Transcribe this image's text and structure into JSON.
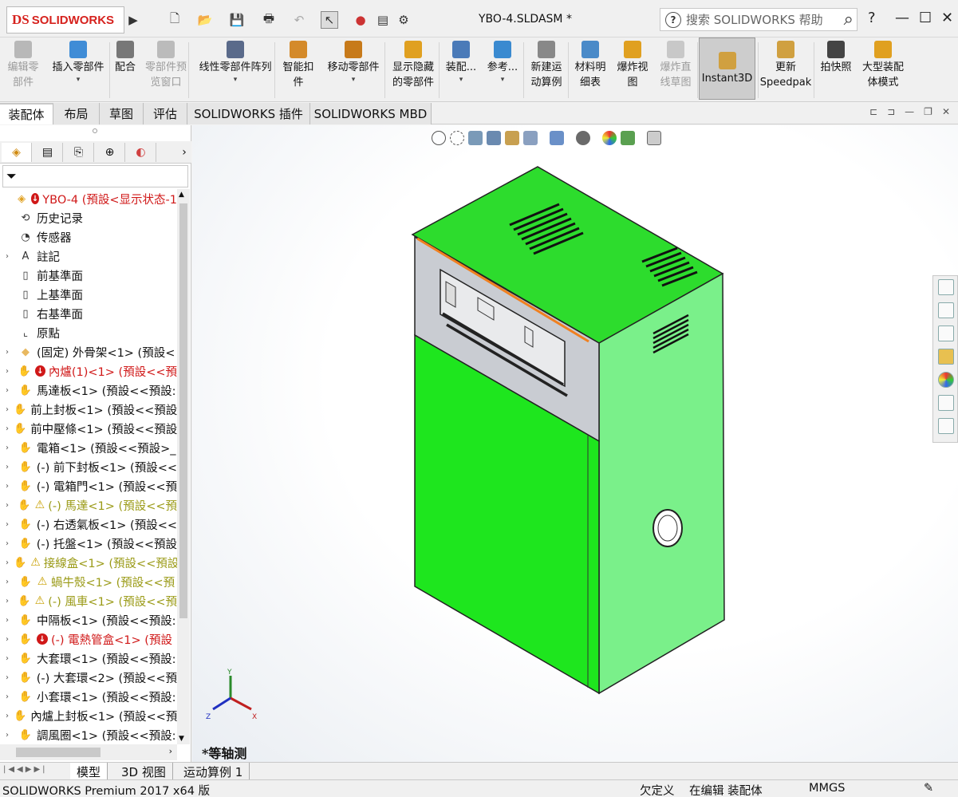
{
  "titlebar": {
    "brand_ds": "DS",
    "brand": "SOLIDWORKS",
    "document_title": "YBO-4.SLDASM *",
    "search_placeholder": "搜索 SOLIDWORKS 帮助",
    "help": "?"
  },
  "commands": [
    {
      "l1": "编辑零",
      "l2": "部件",
      "disabled": true,
      "dd": false,
      "color": "#b8b8b8"
    },
    {
      "l1": "插入零部件",
      "l2": "",
      "disabled": false,
      "dd": true,
      "color": "#3f8cd6"
    },
    {
      "l1": "配合",
      "l2": "",
      "disabled": false,
      "dd": false,
      "color": "#777777"
    },
    {
      "l1": "零部件预",
      "l2": "览窗口",
      "disabled": true,
      "dd": false,
      "color": "#bbbbbb"
    },
    {
      "l1": "线性零部件阵列",
      "l2": "",
      "disabled": false,
      "dd": true,
      "color": "#5a6a8a"
    },
    {
      "l1": "智能扣",
      "l2": "件",
      "disabled": false,
      "dd": false,
      "color": "#d48a2a"
    },
    {
      "l1": "移动零部件",
      "l2": "",
      "disabled": false,
      "dd": true,
      "color": "#c77a1a"
    },
    {
      "l1": "显示隐藏",
      "l2": "的零部件",
      "disabled": false,
      "dd": false,
      "color": "#e0a020"
    },
    {
      "l1": "装配...",
      "l2": "",
      "disabled": false,
      "dd": true,
      "color": "#4a7ab8"
    },
    {
      "l1": "参考...",
      "l2": "",
      "disabled": false,
      "dd": true,
      "color": "#3a8ad0"
    },
    {
      "l1": "新建运",
      "l2": "动算例",
      "disabled": false,
      "dd": false,
      "color": "#888888"
    },
    {
      "l1": "材料明",
      "l2": "细表",
      "disabled": false,
      "dd": false,
      "color": "#4a8ac8"
    },
    {
      "l1": "爆炸视",
      "l2": "图",
      "disabled": false,
      "dd": false,
      "color": "#e0a020"
    },
    {
      "l1": "爆炸直",
      "l2": "线草图",
      "disabled": true,
      "dd": false,
      "color": "#c8c8c8"
    },
    {
      "l1": "Instant3D",
      "l2": "",
      "disabled": false,
      "dd": false,
      "color": "#d0a040"
    },
    {
      "l1": "更新",
      "l2": "Speedpak",
      "disabled": false,
      "dd": false,
      "color": "#d0a040"
    },
    {
      "l1": "拍快照",
      "l2": "",
      "disabled": false,
      "dd": false,
      "color": "#444444"
    },
    {
      "l1": "大型装配",
      "l2": "体模式",
      "disabled": false,
      "dd": false,
      "color": "#e0a020"
    }
  ],
  "tabs": [
    "装配体",
    "布局",
    "草图",
    "评估",
    "SOLIDWORKS 插件",
    "SOLIDWORKS MBD"
  ],
  "tree": [
    {
      "label": "YBO-4  (預設<显示状态-1",
      "status": "error",
      "arrow": "",
      "icon": "#e0a020",
      "iconglyph": "◈"
    },
    {
      "label": "历史记录",
      "status": "",
      "arrow": "",
      "icon": "#ffffff",
      "iconglyph": "⟲"
    },
    {
      "label": "传感器",
      "status": "",
      "arrow": "",
      "icon": "#ffffff",
      "iconglyph": "◔"
    },
    {
      "label": "註記",
      "status": "",
      "arrow": "›",
      "icon": "#ffffff",
      "iconglyph": "A"
    },
    {
      "label": "前基準面",
      "status": "",
      "arrow": "",
      "icon": "#ffffff",
      "iconglyph": "▯"
    },
    {
      "label": "上基準面",
      "status": "",
      "arrow": "",
      "icon": "#ffffff",
      "iconglyph": "▯"
    },
    {
      "label": "右基準面",
      "status": "",
      "arrow": "",
      "icon": "#ffffff",
      "iconglyph": "▯"
    },
    {
      "label": "原點",
      "status": "",
      "arrow": "",
      "icon": "#ffffff",
      "iconglyph": "⌞"
    },
    {
      "label": "(固定) 外骨架<1> (預設<",
      "status": "",
      "arrow": "›",
      "icon": "#e8b860",
      "iconglyph": "◆"
    },
    {
      "label": "內爐(1)<1> (預設<<預",
      "status": "error",
      "arrow": "›",
      "icon": "#f0b020",
      "iconglyph": "✋"
    },
    {
      "label": "馬達板<1> (預設<<預設:",
      "status": "",
      "arrow": "›",
      "icon": "#f0b020",
      "iconglyph": "✋"
    },
    {
      "label": "前上封板<1> (預設<<預設",
      "status": "",
      "arrow": "›",
      "icon": "#f0b020",
      "iconglyph": "✋"
    },
    {
      "label": "前中壓條<1> (預設<<預設",
      "status": "",
      "arrow": "›",
      "icon": "#f0b020",
      "iconglyph": "✋"
    },
    {
      "label": "電箱<1> (預設<<預設>_",
      "status": "",
      "arrow": "›",
      "icon": "#f0b020",
      "iconglyph": "✋"
    },
    {
      "label": "(-) 前下封板<1> (預設<<",
      "status": "",
      "arrow": "›",
      "icon": "#f0b020",
      "iconglyph": "✋"
    },
    {
      "label": "(-) 電箱門<1> (預設<<預",
      "status": "",
      "arrow": "›",
      "icon": "#f0b020",
      "iconglyph": "✋"
    },
    {
      "label": "(-) 馬達<1> (預設<<預",
      "status": "warning",
      "arrow": "›",
      "icon": "#f0b020",
      "iconglyph": "✋"
    },
    {
      "label": "(-) 右透氣板<1> (預設<<",
      "status": "",
      "arrow": "›",
      "icon": "#f0b020",
      "iconglyph": "✋"
    },
    {
      "label": "(-) 托盤<1> (預設<<預設",
      "status": "",
      "arrow": "›",
      "icon": "#f0b020",
      "iconglyph": "✋"
    },
    {
      "label": "接線盒<1> (預設<<預設",
      "status": "warning",
      "arrow": "›",
      "icon": "#f0b020",
      "iconglyph": "✋"
    },
    {
      "label": "蝸牛殼<1> (預設<<預",
      "status": "warning",
      "arrow": "›",
      "icon": "#f0b020",
      "iconglyph": "✋"
    },
    {
      "label": "(-) 風車<1> (預設<<預",
      "status": "warning",
      "arrow": "›",
      "icon": "#f0b020",
      "iconglyph": "✋"
    },
    {
      "label": "中隔板<1> (預設<<預設:",
      "status": "",
      "arrow": "›",
      "icon": "#f0b020",
      "iconglyph": "✋"
    },
    {
      "label": "(-) 電熱管盒<1> (預設",
      "status": "error",
      "arrow": "›",
      "icon": "#f0b020",
      "iconglyph": "✋"
    },
    {
      "label": "大套環<1> (預設<<預設:",
      "status": "",
      "arrow": "›",
      "icon": "#f0b020",
      "iconglyph": "✋"
    },
    {
      "label": "(-) 大套環<2> (預設<<預",
      "status": "",
      "arrow": "›",
      "icon": "#f0b020",
      "iconglyph": "✋"
    },
    {
      "label": "小套環<1> (預設<<預設:",
      "status": "",
      "arrow": "›",
      "icon": "#f0b020",
      "iconglyph": "✋"
    },
    {
      "label": "內爐上封板<1> (預設<<預",
      "status": "",
      "arrow": "›",
      "icon": "#f0b020",
      "iconglyph": "✋"
    },
    {
      "label": "調風圈<1> (預設<<預設:",
      "status": "",
      "arrow": "›",
      "icon": "#f0b020",
      "iconglyph": "✋"
    }
  ],
  "viewport": {
    "view_label": "*等轴测",
    "axis_y": "Y",
    "axis_x": "X",
    "axis_z": "Z"
  },
  "bottom_tabs": [
    "模型",
    "3D 视图",
    "运动算例 1"
  ],
  "status": {
    "product": "SOLIDWORKS Premium 2017 x64 版",
    "defined": "欠定义",
    "editing": "在编辑 装配体",
    "units": "MMGS"
  },
  "colors": {
    "front_green": "#1ee61e",
    "side_green": "#7af08a",
    "top_green": "#2ddc2d",
    "error_red": "#d01818",
    "warning_yellow": "#9a9a16"
  }
}
